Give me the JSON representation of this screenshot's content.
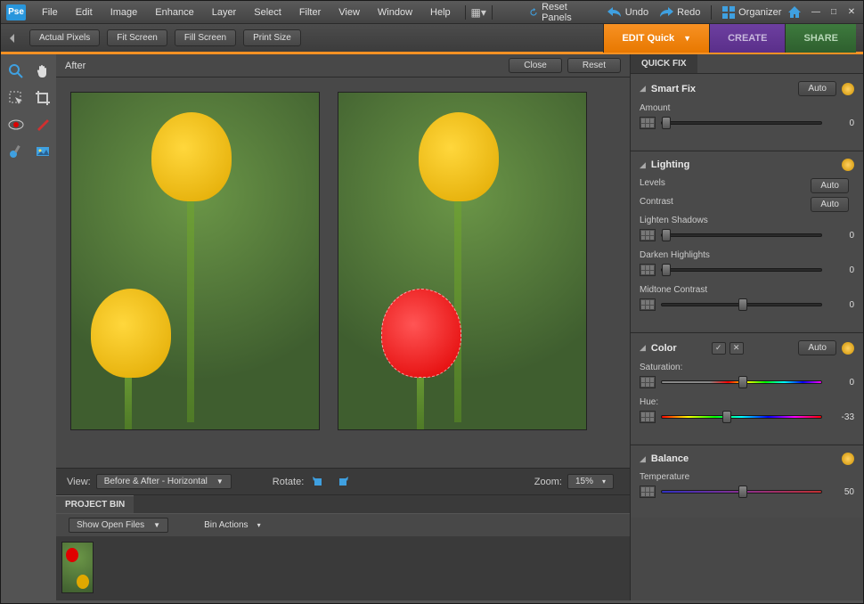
{
  "app_logo": "Pse",
  "menu": [
    "File",
    "Edit",
    "Image",
    "Enhance",
    "Layer",
    "Select",
    "Filter",
    "View",
    "Window",
    "Help"
  ],
  "top_actions": {
    "reset_panels": "Reset Panels",
    "undo": "Undo",
    "redo": "Redo",
    "organizer": "Organizer"
  },
  "options_bar": [
    "Actual Pixels",
    "Fit Screen",
    "Fill Screen",
    "Print Size"
  ],
  "main_tabs": {
    "edit": "EDIT Quick",
    "create": "CREATE",
    "share": "SHARE"
  },
  "canvas": {
    "header_label": "After",
    "close": "Close",
    "reset": "Reset",
    "view_label": "View:",
    "view_mode": "Before & After - Horizontal",
    "rotate_label": "Rotate:",
    "zoom_label": "Zoom:",
    "zoom_value": "15%"
  },
  "project_bin": {
    "title": "PROJECT BIN",
    "dropdown": "Show Open Files",
    "bin_actions": "Bin Actions"
  },
  "right_panel": {
    "tab": "QUICK FIX",
    "smart_fix": {
      "title": "Smart Fix",
      "auto": "Auto",
      "amount_label": "Amount",
      "amount": 0
    },
    "lighting": {
      "title": "Lighting",
      "levels_label": "Levels",
      "levels_auto": "Auto",
      "contrast_label": "Contrast",
      "contrast_auto": "Auto",
      "lighten_label": "Lighten Shadows",
      "lighten": 0,
      "darken_label": "Darken Highlights",
      "darken": 0,
      "midtone_label": "Midtone Contrast",
      "midtone": 0
    },
    "color": {
      "title": "Color",
      "auto": "Auto",
      "saturation_label": "Saturation:",
      "saturation": 0,
      "hue_label": "Hue:",
      "hue": -33
    },
    "balance": {
      "title": "Balance",
      "temperature_label": "Temperature",
      "temperature": 50
    }
  }
}
